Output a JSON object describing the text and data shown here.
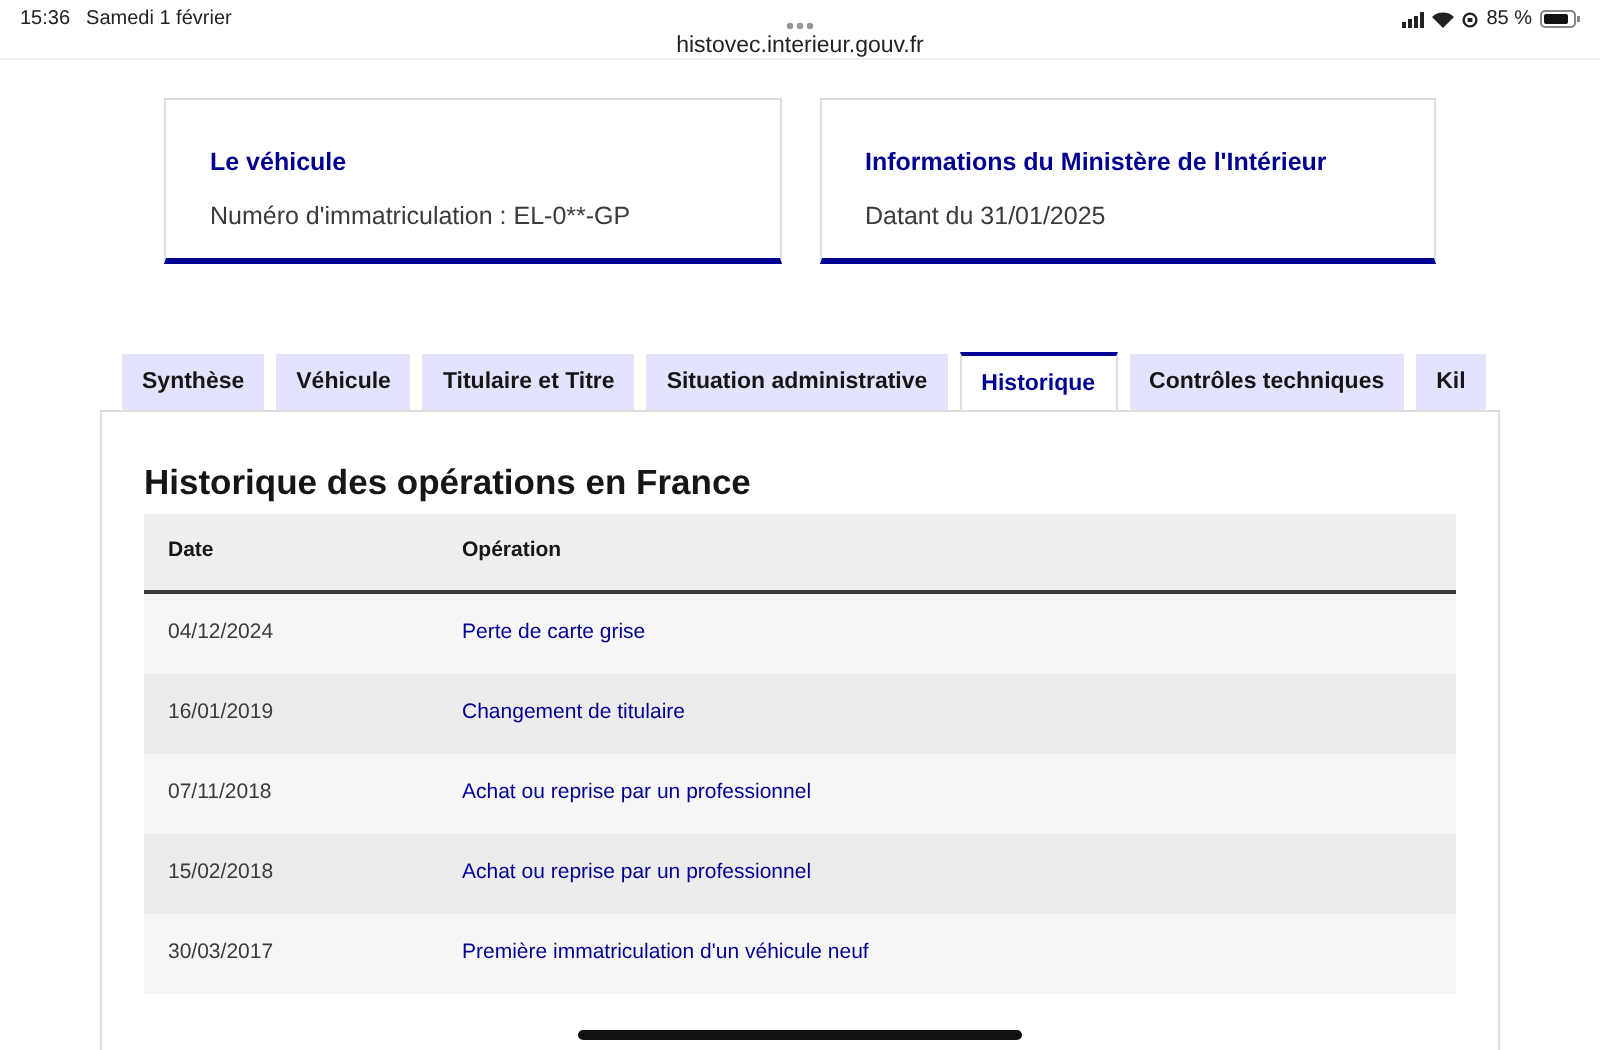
{
  "status_bar": {
    "time": "15:36",
    "date": "Samedi 1 février",
    "battery": "85 %",
    "url": "histovec.interieur.gouv.fr"
  },
  "cards": [
    {
      "title": "Le véhicule",
      "text": "Numéro d'immatriculation : EL-0**-GP"
    },
    {
      "title": "Informations du Ministère de l'Intérieur",
      "text": "Datant du 31/01/2025"
    }
  ],
  "tabs": [
    {
      "label": "Synthèse",
      "selected": false
    },
    {
      "label": "Véhicule",
      "selected": false
    },
    {
      "label": "Titulaire et Titre",
      "selected": false
    },
    {
      "label": "Situation administrative",
      "selected": false
    },
    {
      "label": "Historique",
      "selected": true
    },
    {
      "label": "Contrôles techniques",
      "selected": false
    },
    {
      "label": "Kil",
      "selected": false
    }
  ],
  "section_title": "Historique des opérations en France",
  "table": {
    "columns": [
      "Date",
      "Opération"
    ],
    "rows": [
      [
        "04/12/2024",
        "Perte de carte grise"
      ],
      [
        "16/01/2019",
        "Changement de titulaire"
      ],
      [
        "07/11/2018",
        "Achat ou reprise par un professionnel"
      ],
      [
        "15/02/2018",
        "Achat ou reprise par un professionnel"
      ],
      [
        "30/03/2017",
        "Première immatriculation d'un véhicule neuf"
      ]
    ]
  }
}
